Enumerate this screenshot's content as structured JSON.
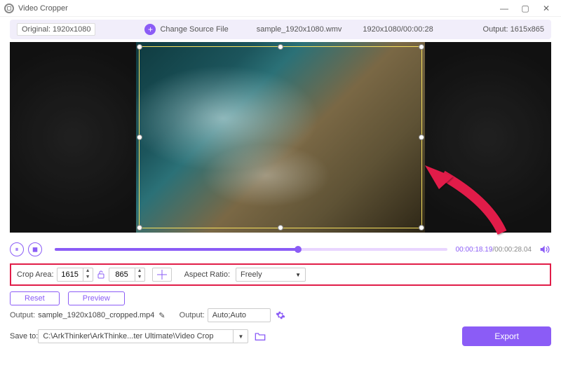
{
  "titlebar": {
    "app_name": "Video Cropper"
  },
  "infobar": {
    "original_label": "Original: 1920x1080",
    "change_source": "Change Source File",
    "filename": "sample_1920x1080.wmv",
    "dims_time": "1920x1080/00:00:28",
    "output_label": "Output: 1615x865"
  },
  "playback": {
    "current_time": "00:00:18.19",
    "total_time": "/00:00:28.04"
  },
  "crop": {
    "label": "Crop Area:",
    "width": "1615",
    "height": "865",
    "aspect_label": "Aspect Ratio:",
    "aspect_value": "Freely"
  },
  "buttons": {
    "reset": "Reset",
    "preview": "Preview",
    "export": "Export"
  },
  "output": {
    "label1": "Output:",
    "filename": "sample_1920x1080_cropped.mp4",
    "label2": "Output:",
    "preset": "Auto;Auto"
  },
  "save": {
    "label": "Save to:",
    "path": "C:\\ArkThinker\\ArkThinke...ter Ultimate\\Video Crop"
  }
}
